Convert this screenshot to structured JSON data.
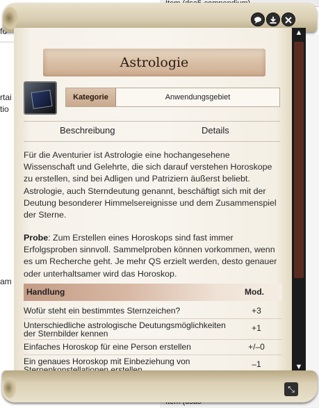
{
  "background": {
    "top_strip_text": "Item (dsa5-compendium)",
    "bottom_strip_text": "Item (dsa5-",
    "left_fragments": [
      "fo",
      "rtai",
      "tio",
      "am"
    ]
  },
  "window": {
    "buttons": [
      "speech-bubble-icon",
      "download-icon",
      "close-icon"
    ],
    "scroll_up": "▲",
    "scroll_down": "▼",
    "resize": "⤡"
  },
  "item": {
    "title": "Astrologie",
    "category_label": "Kategorie",
    "category_value": "Anwendungsgebiet"
  },
  "tabs": [
    {
      "label": "Beschreibung"
    },
    {
      "label": "Details"
    }
  ],
  "description": "Für die Aventurier ist Astrologie eine hochangesehene Wissenschaft und Gelehrte, die sich darauf verstehen Horoskope zu erstellen, sind bei Adligen und Patriziern äußerst beliebt. Astrologie, auch Sterndeutung genannt, beschäftigt sich mit der Deutung besonderer Himmelsereignisse und dem Zusammenspiel der Sterne.",
  "probe": {
    "label": "Probe",
    "text": ": Zum Erstellen eines Horoskops sind fast immer Erfolgsproben sinnvoll. Sammelproben können vorkommen, wenn es um Recherche geht. Je mehr QS erzielt werden, desto genauer oder unterhaltsamer wird das Horoskop."
  },
  "table": {
    "col_action": "Handlung",
    "col_mod": "Mod.",
    "rows": [
      {
        "action": "Wofür steht ein bestimmtes Sternzeichen?",
        "mod": "+3"
      },
      {
        "action": "Unterschiedliche astrologische Deutungsmöglichkeiten der Sternbilder kennen",
        "mod": "+1"
      },
      {
        "action": "Einfaches Horoskop für eine Person erstellen",
        "mod": "+/–0"
      },
      {
        "action": "Ein genaues Horoskop mit Einbeziehung von Sternenkonstellationen erstellen",
        "mod": "–1"
      }
    ]
  }
}
